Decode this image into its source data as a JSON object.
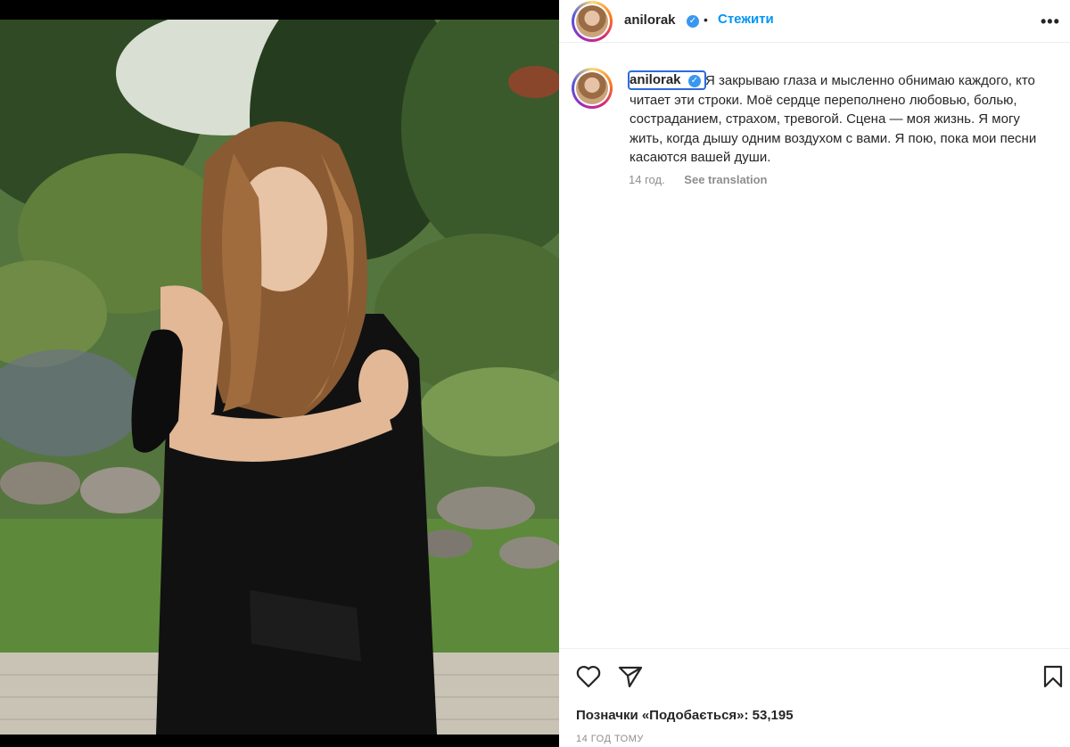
{
  "post": {
    "username": "anilorak",
    "separator": "•",
    "follow_label": "Стежити",
    "more_label": "•••",
    "caption": "Я закрываю глаза и мысленно обнимаю каждого, кто читает эти строки. Моё сердце переполнено любовью, болью, состраданием, страхом, тревогой. Сцена — моя жизнь. Я могу жить, когда дышу одним воздухом с вами. Я пою, пока мои песни касаются вашей души.",
    "caption_time": "14 год.",
    "see_translation": "See translation",
    "likes_text": "Позначки «Подобається»: 53,195",
    "post_time": "14 ГОД ТОМУ"
  },
  "icons": {
    "verified": "verified-badge-icon",
    "like": "heart-icon",
    "share": "paper-plane-icon",
    "save": "bookmark-icon",
    "more": "more-dots-icon"
  },
  "colors": {
    "accent": "#0095f6",
    "verified": "#3897f0",
    "muted": "#8e8e8e",
    "text": "#262626"
  }
}
